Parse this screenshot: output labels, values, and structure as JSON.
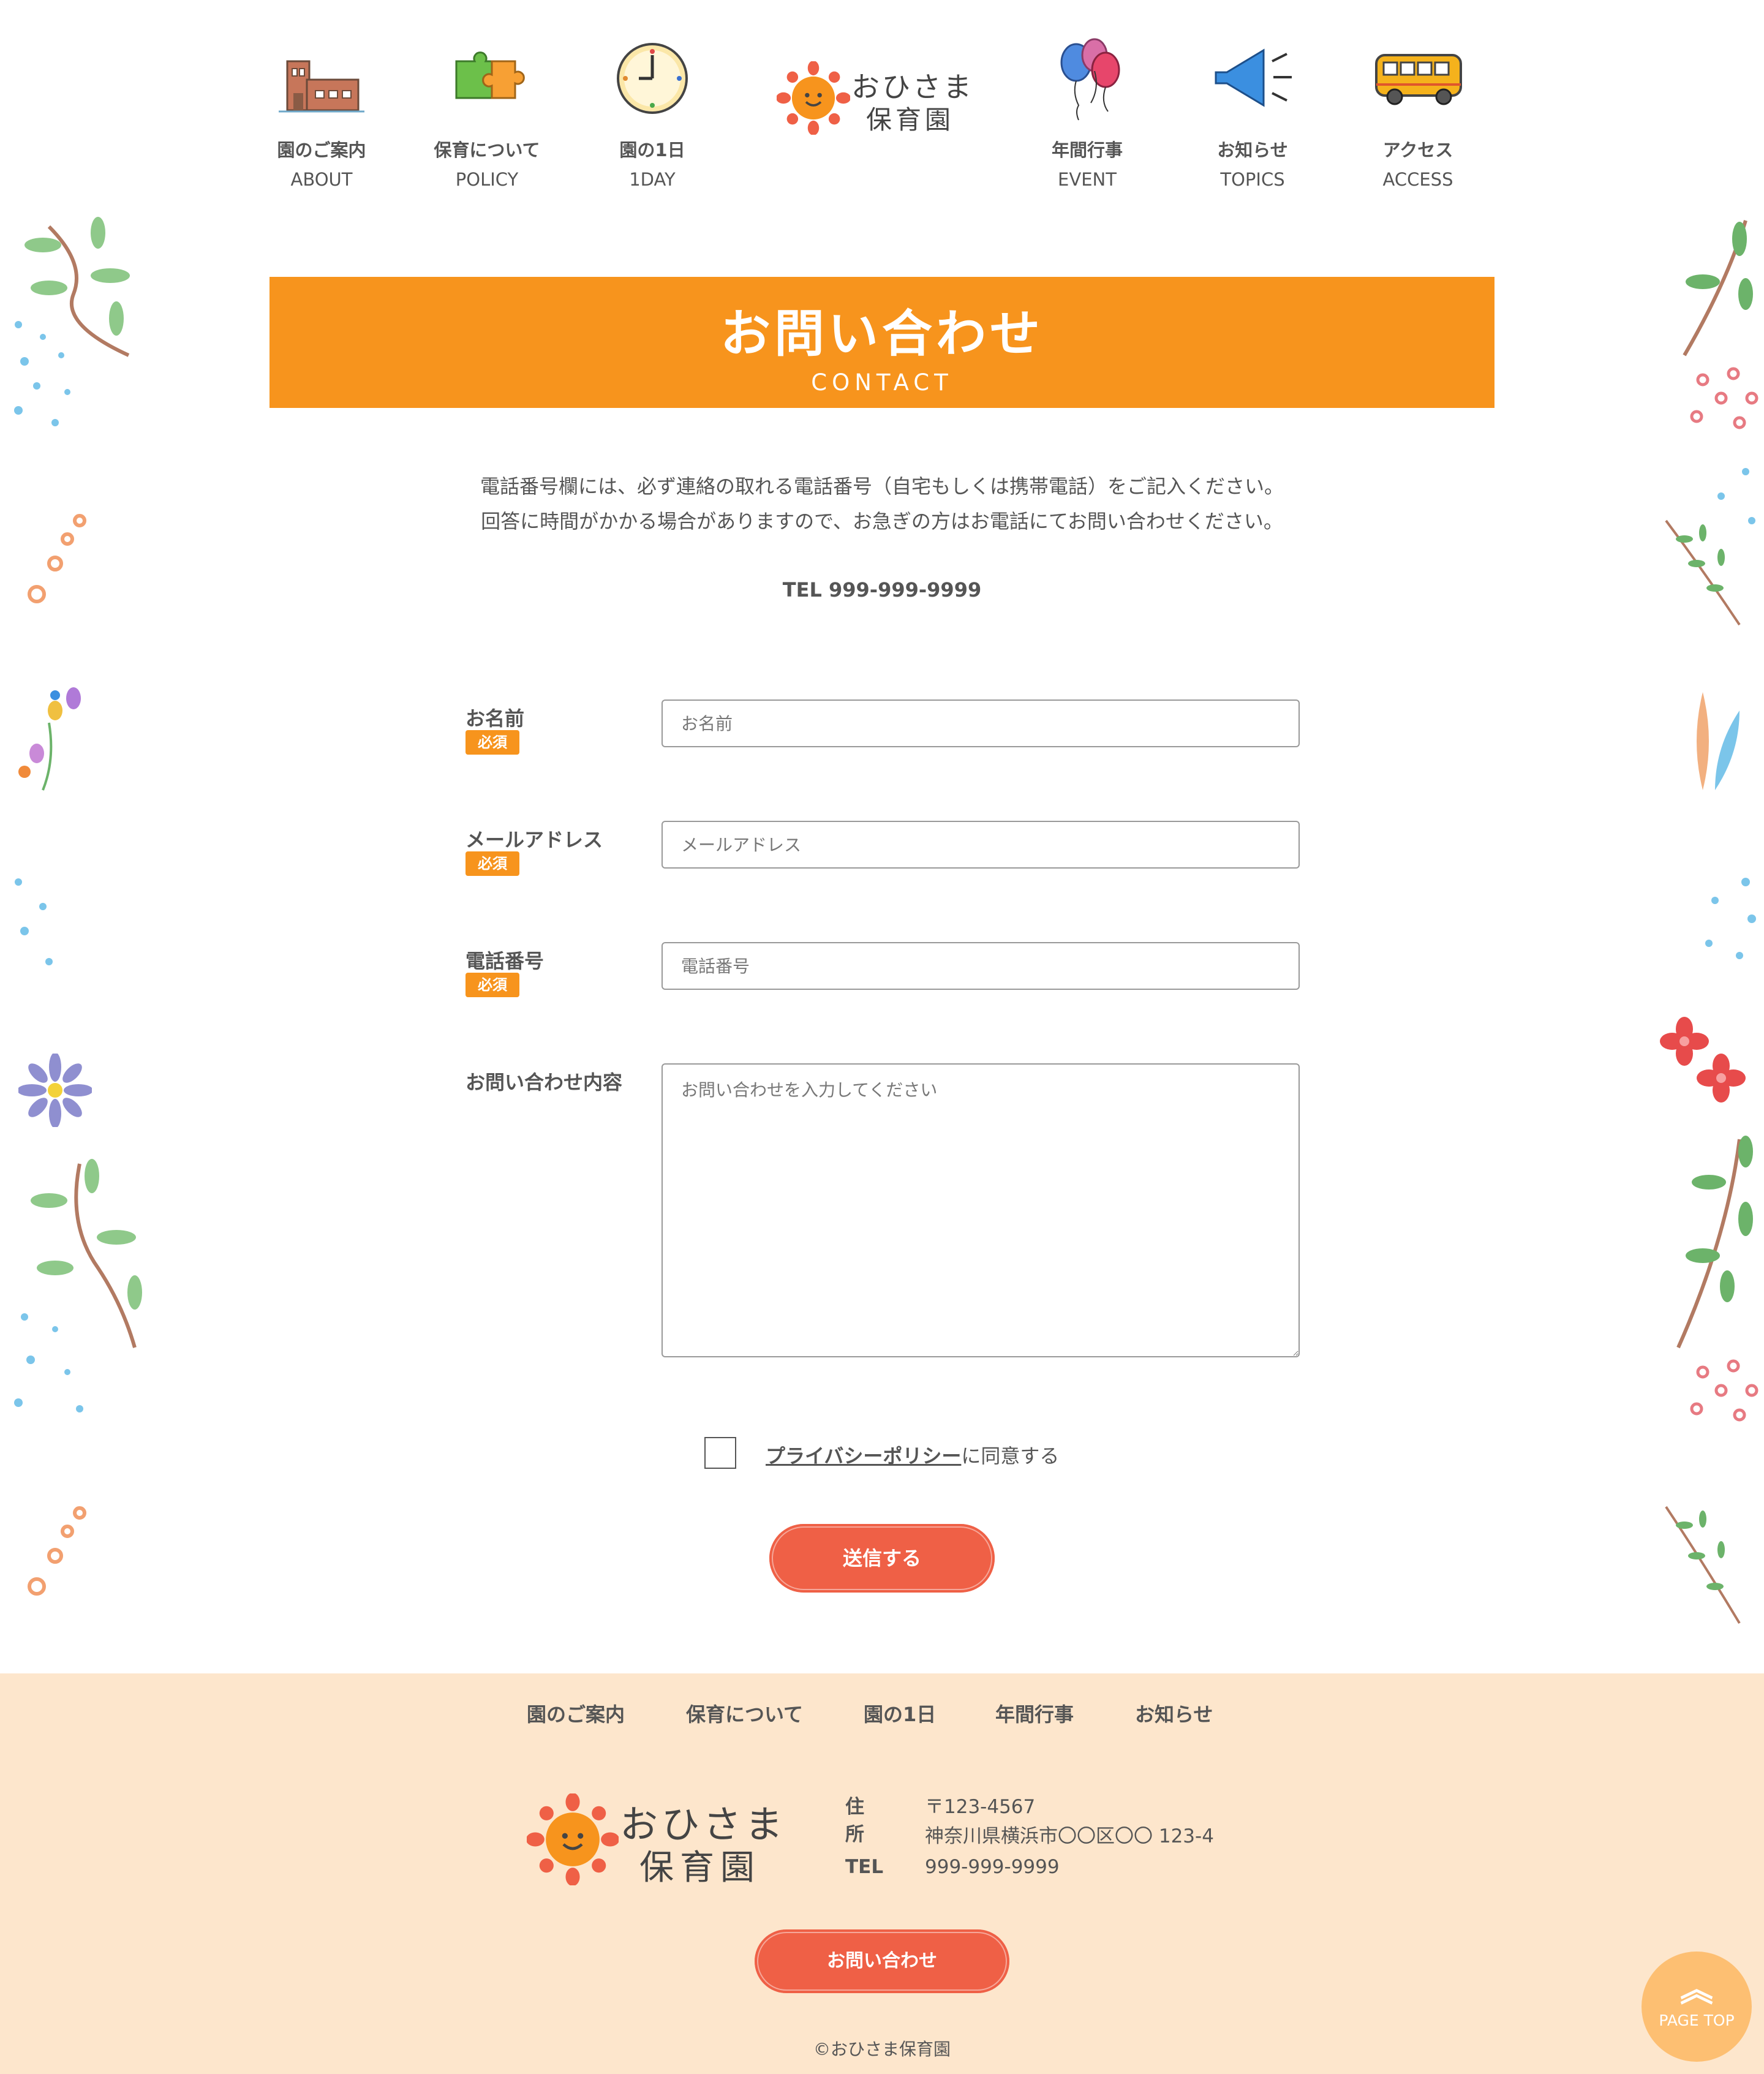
{
  "nav": {
    "items": [
      {
        "ja": "園のご案内",
        "en": "ABOUT",
        "icon": "building-icon"
      },
      {
        "ja": "保育について",
        "en": "POLICY",
        "icon": "puzzle-icon"
      },
      {
        "ja": "園の1日",
        "en": "1DAY",
        "icon": "clock-icon"
      },
      {
        "ja": "年間行事",
        "en": "EVENT",
        "icon": "balloons-icon"
      },
      {
        "ja": "お知らせ",
        "en": "TOPICS",
        "icon": "megaphone-icon"
      },
      {
        "ja": "アクセス",
        "en": "ACCESS",
        "icon": "bus-icon"
      }
    ],
    "logo": {
      "line1": "おひさま",
      "line2": "保育園"
    }
  },
  "page": {
    "title_ja": "お問い合わせ",
    "title_en": "CONTACT"
  },
  "intro": {
    "line1": "電話番号欄には、必ず連絡の取れる電話番号（自宅もしくは携帯電話）をご記入ください。",
    "line2": "回答に時間がかかる場合がありますので、お急ぎの方はお電話にてお問い合わせください。",
    "tel": "TEL 999-999-9999"
  },
  "form": {
    "required_label": "必須",
    "name": {
      "label": "お名前",
      "placeholder": "お名前"
    },
    "email": {
      "label": "メールアドレス",
      "placeholder": "メールアドレス"
    },
    "phone": {
      "label": "電話番号",
      "placeholder": "電話番号"
    },
    "message": {
      "label": "お問い合わせ内容",
      "placeholder": "お問い合わせを入力してください"
    },
    "privacy_link": "プライバシーポリシー",
    "privacy_suffix": "に同意する",
    "submit": "送信する"
  },
  "footer": {
    "nav": [
      "園のご案内",
      "保育について",
      "園の1日",
      "年間行事",
      "お知らせ"
    ],
    "address_label": "住所",
    "postal": "〒123-4567",
    "address": "神奈川県横浜市〇〇区〇〇 123-4",
    "tel_label": "TEL",
    "tel": "999-999-9999",
    "contact_button": "お問い合わせ",
    "copyright": "©おひさま保育園"
  },
  "page_top": {
    "arrow": "︽",
    "label": "PAGE TOP"
  },
  "colors": {
    "accent": "#f7941d",
    "button": "#ef6046",
    "footer_bg": "#fde6cc",
    "page_top": "#fdbf72"
  }
}
